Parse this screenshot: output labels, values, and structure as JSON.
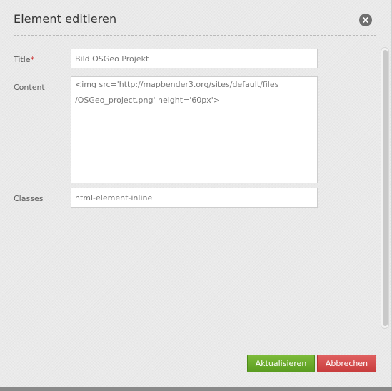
{
  "dialog": {
    "title": "Element editieren",
    "close_icon": "close-icon"
  },
  "form": {
    "title": {
      "label": "Title",
      "required_mark": "*",
      "value": "Bild OSGeo Projekt"
    },
    "content": {
      "label": "Content",
      "value": "<img src='http://mapbender3.org/sites/default/files\n/OSGeo_project.png' height='60px'>"
    },
    "classes": {
      "label": "Classes",
      "value": "html-element-inline"
    }
  },
  "buttons": {
    "update_label": "Aktualisieren",
    "cancel_label": "Abbrechen"
  },
  "colors": {
    "update": "#6aab2c",
    "cancel": "#d44f4f",
    "required": "#cc3333"
  }
}
